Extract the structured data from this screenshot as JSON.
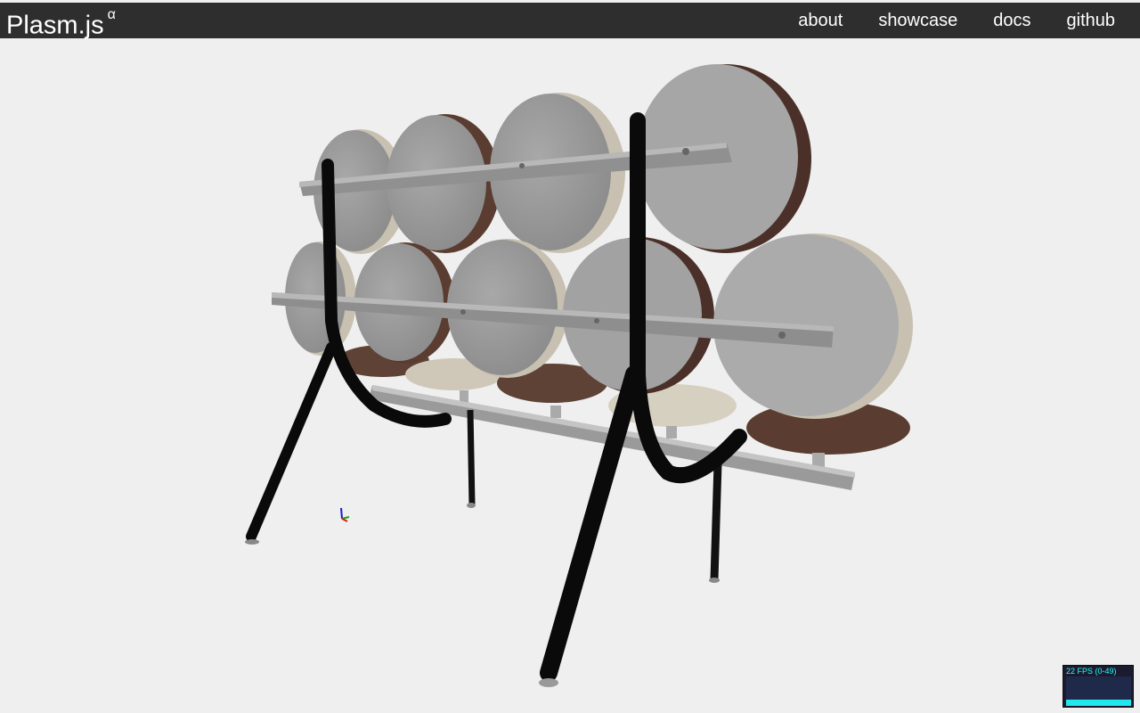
{
  "header": {
    "brand": "Plasm.js",
    "brand_sup": "α",
    "nav": [
      "about",
      "showcase",
      "docs",
      "github"
    ]
  },
  "viewer": {
    "fps_label": "22 FPS (0-49)",
    "fps_fill": 0.22
  },
  "colors": {
    "topbar": "#2e2e2e",
    "background": "#efefef",
    "fps_accent": "#22e8ee"
  }
}
